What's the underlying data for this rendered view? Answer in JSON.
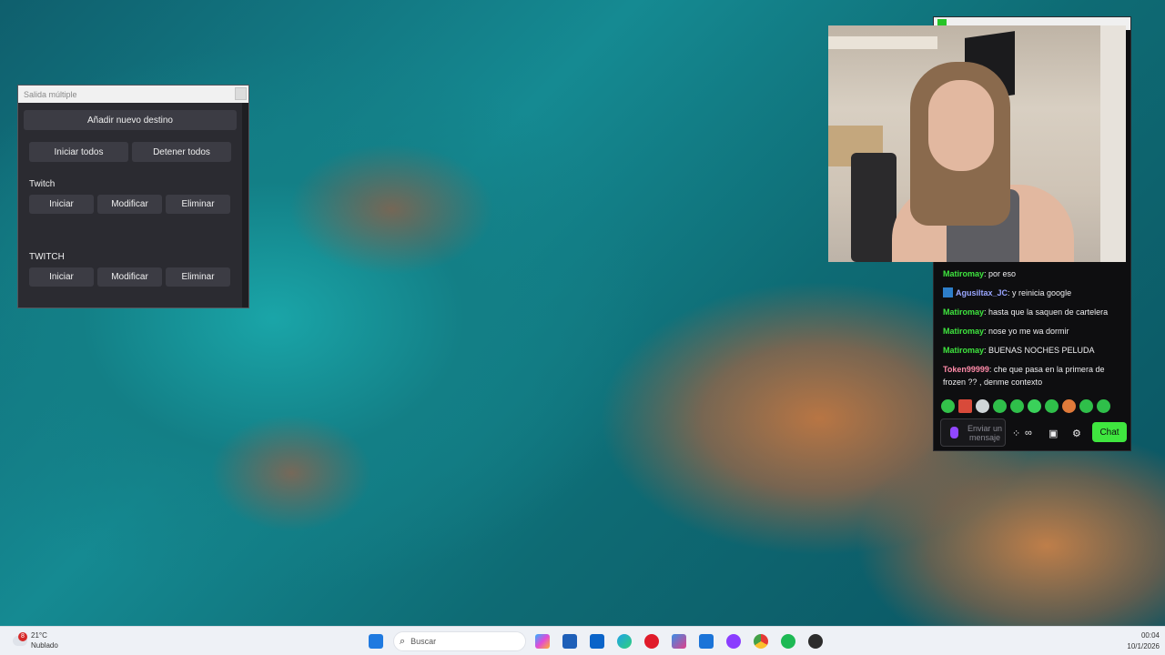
{
  "multiple_output": {
    "title": "Salida múltiple",
    "add_destination": "Añadir nuevo destino",
    "start_all": "Iniciar todos",
    "stop_all": "Detener todos",
    "destinations": [
      {
        "name": "Twitch",
        "start": "Iniciar",
        "edit": "Modificar",
        "delete": "Eliminar"
      },
      {
        "name": "TWITCH",
        "start": "Iniciar",
        "edit": "Modificar",
        "delete": "Eliminar"
      }
    ]
  },
  "chat": {
    "colors": {
      "username_green": "#3fe63f",
      "send_button": "#3fe63f",
      "mic": "#9147ff"
    },
    "messages": [
      {
        "user": "Matiromay",
        "text": ": por eso"
      },
      {
        "user": "Agusiltax_JC",
        "text": ": y reinicia google",
        "badge": "blue"
      },
      {
        "user": "Matiromay",
        "text": ": hasta que la saquen de cartelera"
      },
      {
        "user": "Matiromay",
        "text": ": nose yo me wa dormir"
      },
      {
        "user": "Matiromay",
        "text": ": BUENAS NOCHES PELUDA"
      },
      {
        "user": "Token99999",
        "text": ": che que pasa en la primera de frozen ?? , denme contexto"
      }
    ],
    "input_placeholder": "Enviar un mensaje",
    "send_label": "Chat",
    "icons": [
      "mic-icon",
      "emote-icon",
      "share-icon",
      "infinity-icon",
      "gift-icon",
      "gear-icon"
    ]
  },
  "taskbar": {
    "weather": {
      "temp": "21°C",
      "condition": "Nublado",
      "badge": "8"
    },
    "search_placeholder": "Buscar",
    "time": "00:04",
    "date": "10/1/2026",
    "pinned_icons": [
      "windows-start-icon",
      "search-icon",
      "copilot-icon",
      "store-icon",
      "outlook-icon",
      "edge-icon",
      "opera-icon",
      "photos-icon",
      "twitch-icon",
      "chrome-icon",
      "spotify-icon",
      "obs-icon"
    ]
  }
}
